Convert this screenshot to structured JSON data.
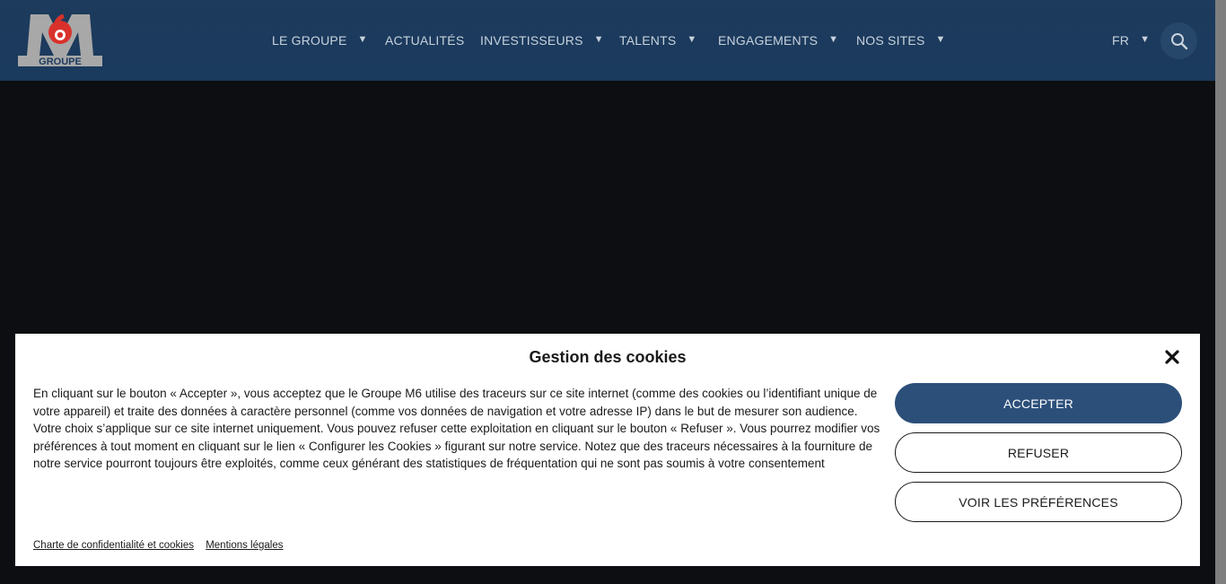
{
  "header": {
    "logo_text": "GROUPE",
    "nav": [
      {
        "label": "LE GROUPE",
        "has_dropdown": true
      },
      {
        "label": "ACTUALITÉS",
        "has_dropdown": false
      },
      {
        "label": "INVESTISSEURS",
        "has_dropdown": true
      },
      {
        "label": "TALENTS",
        "has_dropdown": true
      },
      {
        "label": "ENGAGEMENTS",
        "has_dropdown": true
      },
      {
        "label": "NOS SITES",
        "has_dropdown": true
      }
    ],
    "language": "FR",
    "search_icon": "search-icon",
    "caret_glyph": "▼"
  },
  "cookie_banner": {
    "title": "Gestion des cookies",
    "close_icon": "close-icon",
    "text": "En cliquant sur le bouton « Accepter », vous acceptez que le Groupe M6 utilise des traceurs sur ce site internet (comme des cookies ou l’identifiant unique de votre appareil) et traite des données à caractère personnel (comme vos données de navigation et votre adresse IP) dans le but de mesurer son audience. Votre choix s’applique sur ce site internet uniquement. Vous pouvez refuser cette exploitation en cliquant sur le bouton « Refuser ». Vous pourrez modifier vos préférences à tout moment en cliquant sur le lien « Configurer les Cookies » figurant sur notre service. Notez que des traceurs nécessaires à la fourniture de notre service pourront toujours être exploités, comme ceux générant des statistiques de fréquentation qui ne sont pas soumis à votre consentement",
    "accept_label": "ACCEPTER",
    "refuse_label": "REFUSER",
    "prefs_label": "VOIR LES PRÉFÉRENCES",
    "links": {
      "privacy": "Charte de confidentialité et cookies",
      "legal": "Mentions légales"
    }
  },
  "colors": {
    "header_bg": "#1a3a5e",
    "accent": "#2c4f7a",
    "logo_red": "#d9312b",
    "logo_gray": "#a8a8a8",
    "page_bg": "#0d0e11"
  }
}
